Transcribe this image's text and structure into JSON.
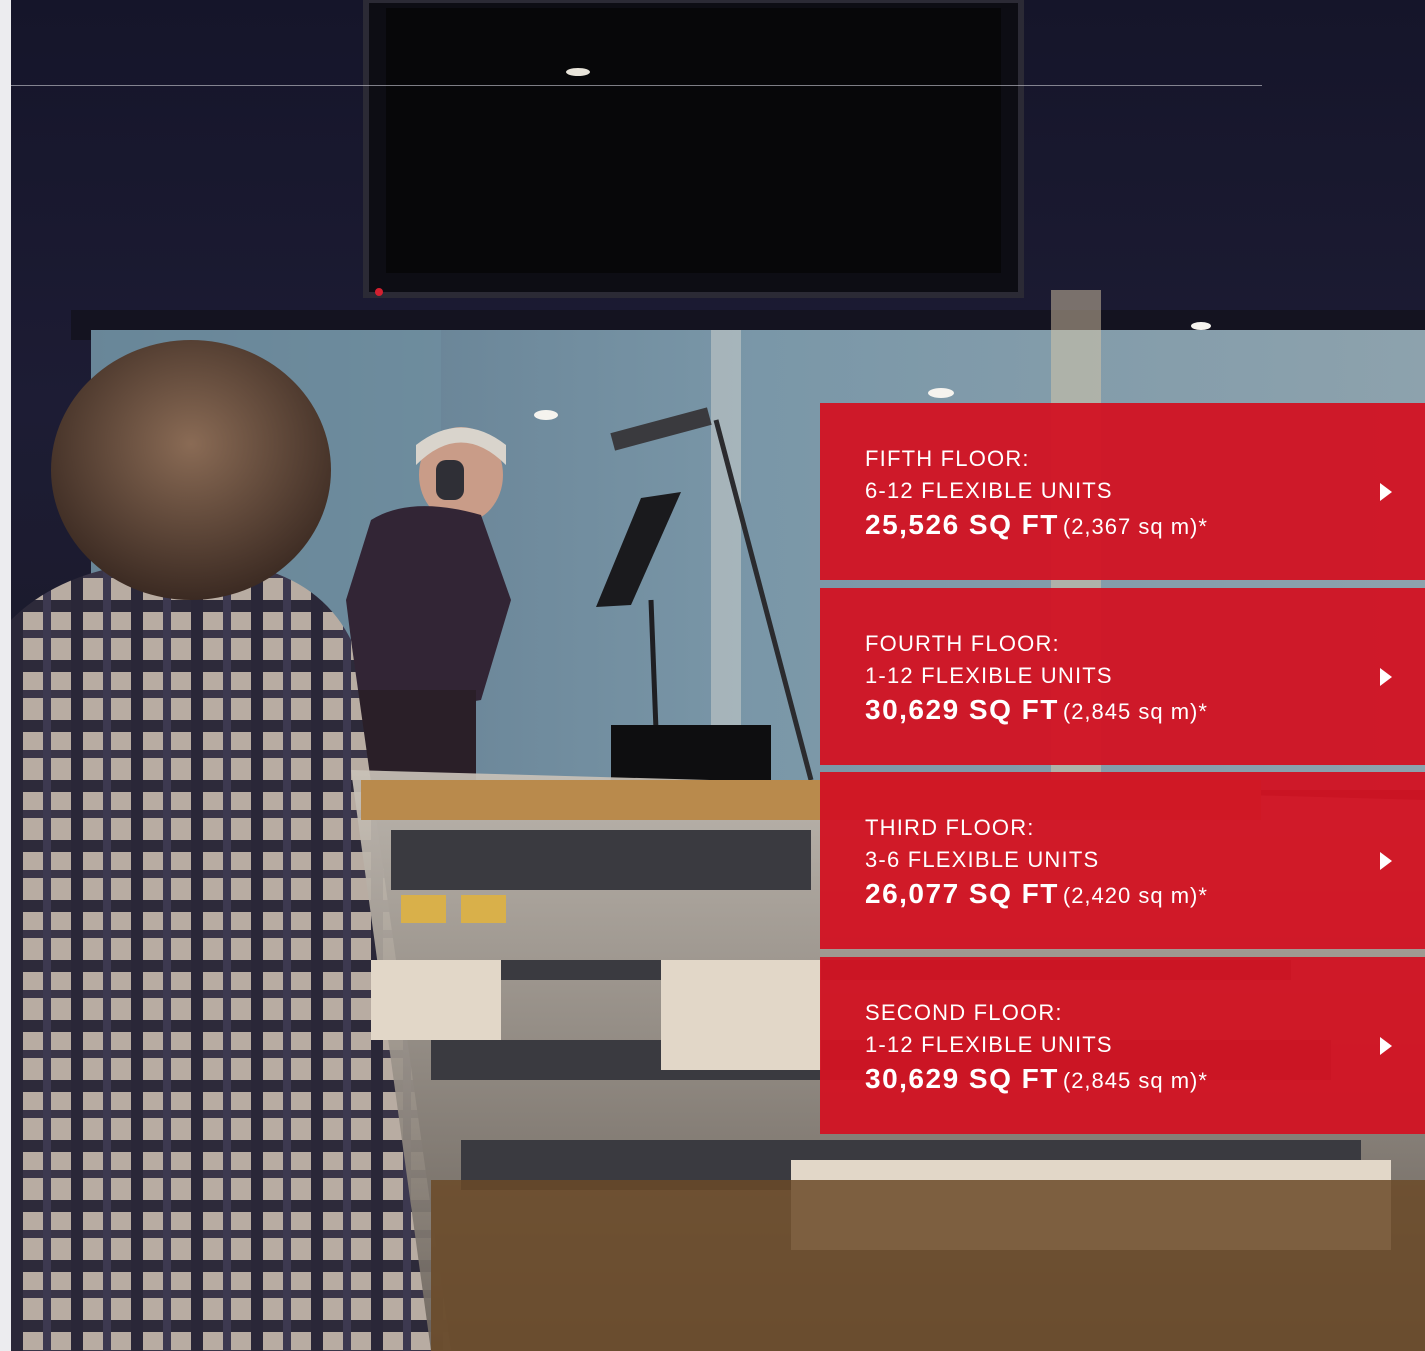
{
  "page": {
    "accent_color": "#d11423",
    "photo_alt": "Recording studio with engineer at mixing console and vocalist at microphone"
  },
  "floors": [
    {
      "name": "FIFTH FLOOR:",
      "units": "6-12 FLEXIBLE UNITS",
      "sqft": "25,526 SQ FT",
      "sqm": "(2,367 sq m)*",
      "arrow_icon": "play-arrow-icon"
    },
    {
      "name": "FOURTH FLOOR:",
      "units": "1-12 FLEXIBLE UNITS",
      "sqft": "30,629 SQ FT",
      "sqm": "(2,845 sq m)*",
      "arrow_icon": "play-arrow-icon"
    },
    {
      "name": "THIRD FLOOR:",
      "units": "3-6 FLEXIBLE UNITS",
      "sqft": "26,077 SQ FT",
      "sqm": "(2,420 sq m)*",
      "arrow_icon": "play-arrow-icon"
    },
    {
      "name": "SECOND FLOOR:",
      "units": "1-12 FLEXIBLE UNITS",
      "sqft": "30,629 SQ FT",
      "sqm": "(2,845 sq m)*",
      "arrow_icon": "play-arrow-icon"
    }
  ]
}
